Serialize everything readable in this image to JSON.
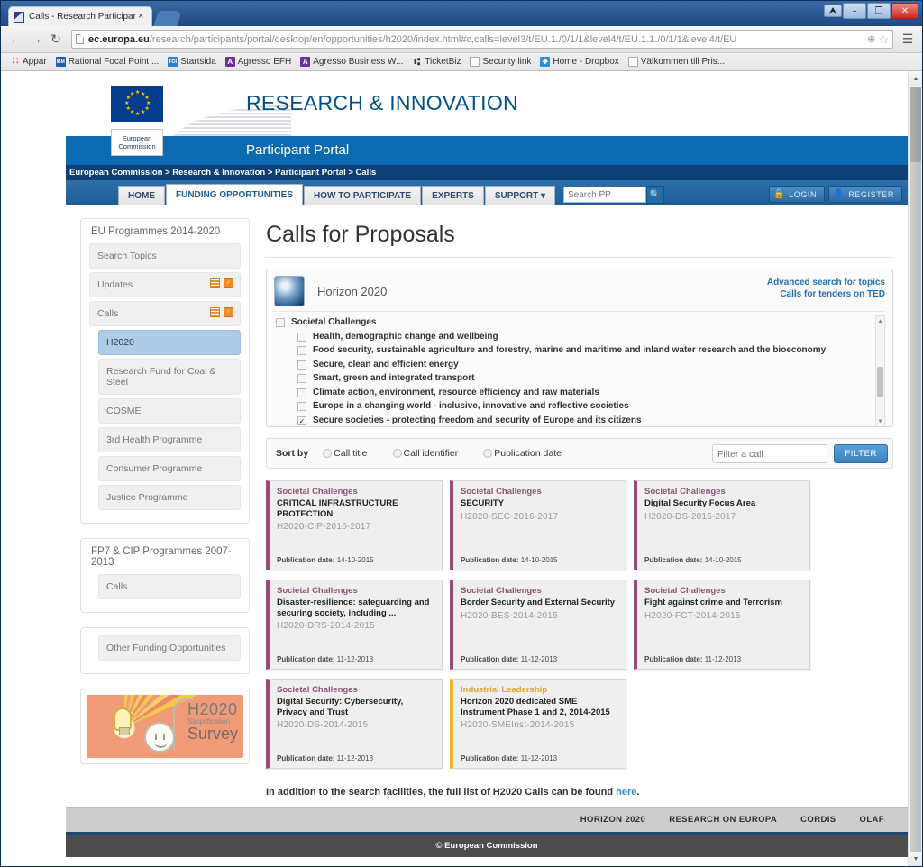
{
  "browser": {
    "tab_title": "Calls - Research Participar",
    "tab_close": "×",
    "back_icon": "←",
    "forward_icon": "→",
    "reload_icon": "↻",
    "url_host": "ec.europa.eu",
    "url_path": "/research/participants/portal/desktop/en/opportunities/h2020/index.html#c,calls=level3/t/EU.1./0/1/1&level4/t/EU.1.1./0/1/1&level4/t/EU",
    "zoom_icon": "⊕",
    "star_icon": "☆",
    "menu_icon": "☰",
    "minimize": "–",
    "maximize": "❐",
    "close": "✕",
    "restore": "⮝",
    "bookmarks": [
      {
        "label": "Appar",
        "icon": "apps-icon",
        "glyph": "∷"
      },
      {
        "label": "Rational Focal Point ...",
        "icon": "ibm-icon",
        "glyph": "IBM"
      },
      {
        "label": "Startsida",
        "icon": "foi-icon",
        "glyph": "FOI"
      },
      {
        "label": "Agresso EFH",
        "icon": "agresso-icon",
        "glyph": "A"
      },
      {
        "label": "Agresso Business W...",
        "icon": "agresso-icon",
        "glyph": "A"
      },
      {
        "label": "TicketBiz",
        "icon": "ticketbiz-icon",
        "glyph": "⑆"
      },
      {
        "label": "Security link",
        "icon": "page-icon",
        "glyph": ""
      },
      {
        "label": "Home - Dropbox",
        "icon": "dropbox-icon",
        "glyph": "❖"
      },
      {
        "label": "Välkommen till Pris...",
        "icon": "page-icon",
        "glyph": ""
      }
    ]
  },
  "site": {
    "brand_title": "RESEARCH & INNOVATION",
    "portal_title": "Participant Portal",
    "ec_badge": "European\nCommission",
    "breadcrumb": "European Commission >  Research & Innovation >  Participant Portal >  Calls",
    "nav": [
      {
        "label": "HOME",
        "active": false
      },
      {
        "label": "FUNDING OPPORTUNITIES",
        "active": true
      },
      {
        "label": "HOW TO PARTICIPATE",
        "active": false
      },
      {
        "label": "EXPERTS",
        "active": false
      },
      {
        "label": "SUPPORT ▾",
        "active": false
      }
    ],
    "search_placeholder": "Search PP",
    "search_value": "",
    "search_icon": "🔍",
    "login_label": "LOGIN",
    "login_icon": "🔒",
    "register_label": "REGISTER",
    "register_icon": "👤"
  },
  "sidebar": {
    "panel1_title": "EU Programmes 2014-2020",
    "panel1_items": [
      {
        "label": "Search Topics",
        "indent": false,
        "active": false,
        "icons": []
      },
      {
        "label": "Updates",
        "indent": false,
        "active": false,
        "icons": [
          "calendar-icon",
          "rss-icon"
        ]
      },
      {
        "label": "Calls",
        "indent": false,
        "active": false,
        "icons": [
          "calendar-icon",
          "rss-icon"
        ]
      },
      {
        "label": "H2020",
        "indent": true,
        "active": true,
        "icons": []
      },
      {
        "label": "Research Fund for Coal & Steel",
        "indent": true,
        "active": false,
        "icons": []
      },
      {
        "label": "COSME",
        "indent": true,
        "active": false,
        "icons": []
      },
      {
        "label": "3rd Health Programme",
        "indent": true,
        "active": false,
        "icons": []
      },
      {
        "label": "Consumer Programme",
        "indent": true,
        "active": false,
        "icons": []
      },
      {
        "label": "Justice Programme",
        "indent": true,
        "active": false,
        "icons": []
      }
    ],
    "panel2_title": "FP7 & CIP Programmes 2007-2013",
    "panel2_items": [
      {
        "label": "Calls",
        "indent": true,
        "active": false,
        "icons": []
      }
    ],
    "panel3_items": [
      {
        "label": "Other Funding Opportunities",
        "indent": true,
        "active": false,
        "icons": []
      }
    ],
    "survey": {
      "line1": "H2020",
      "line2": "Simplification",
      "line3": "Survey"
    }
  },
  "main": {
    "page_title": "Calls for Proposals",
    "programme_name": "Horizon 2020",
    "advanced_search_link": "Advanced search for topics",
    "ted_link": "Calls for tenders on TED",
    "tree": [
      {
        "level": 0,
        "label": "Societal Challenges",
        "checked": false
      },
      {
        "level": 1,
        "label": "Health, demographic change and wellbeing",
        "checked": false
      },
      {
        "level": 1,
        "label": "Food security, sustainable agriculture and forestry, marine and maritime and inland water research and the bioeconomy",
        "checked": false
      },
      {
        "level": 1,
        "label": "Secure, clean and efficient energy",
        "checked": false
      },
      {
        "level": 1,
        "label": "Smart, green and integrated transport",
        "checked": false
      },
      {
        "level": 1,
        "label": "Climate action, environment, resource efficiency and raw materials",
        "checked": false
      },
      {
        "level": 1,
        "label": "Europe in a changing world - inclusive, innovative and reflective societies",
        "checked": false
      },
      {
        "level": 1,
        "label": "Secure societies - protecting freedom and security of Europe and its citizens",
        "checked": true
      }
    ],
    "sort": {
      "label": "Sort by",
      "options": [
        {
          "label": "Call title",
          "selected": false
        },
        {
          "label": "Call identifier",
          "selected": false
        },
        {
          "label": "Publication date",
          "selected": false
        }
      ],
      "filter_placeholder": "Filter a call",
      "filter_value": "",
      "filter_button": "FILTER"
    },
    "pub_prefix": "Publication date:",
    "cards": [
      {
        "category": "Societal Challenges",
        "title": "CRITICAL INFRASTRUCTURE PROTECTION",
        "identifier": "H2020-CIP-2016-2017",
        "pub_date": "14-10-2015",
        "accent": "societal"
      },
      {
        "category": "Societal Challenges",
        "title": "SECURITY",
        "identifier": "H2020-SEC-2016-2017",
        "pub_date": "14-10-2015",
        "accent": "societal"
      },
      {
        "category": "Societal Challenges",
        "title": "Digital Security Focus Area",
        "identifier": "H2020-DS-2016-2017",
        "pub_date": "14-10-2015",
        "accent": "societal"
      },
      {
        "category": "Societal Challenges",
        "title": "Disaster-resilience: safeguarding and securing society, including ...",
        "identifier": "H2020-DRS-2014-2015",
        "pub_date": "11-12-2013",
        "accent": "societal"
      },
      {
        "category": "Societal Challenges",
        "title": "Border Security and External Security",
        "identifier": "H2020-BES-2014-2015",
        "pub_date": "11-12-2013",
        "accent": "societal"
      },
      {
        "category": "Societal Challenges",
        "title": "Fight against crime and Terrorism",
        "identifier": "H2020-FCT-2014-2015",
        "pub_date": "11-12-2013",
        "accent": "societal"
      },
      {
        "category": "Societal Challenges",
        "title": "Digital Security: Cybersecurity, Privacy and Trust",
        "identifier": "H2020-DS-2014-2015",
        "pub_date": "11-12-2013",
        "accent": "societal"
      },
      {
        "category": "Industrial Leadership",
        "title": "Horizon 2020 dedicated SME Instrument Phase 1 and 2, 2014-2015",
        "identifier": "H2020-SMEInst-2014-2015",
        "pub_date": "11-12-2013",
        "accent": "industrial"
      }
    ],
    "fulllist_text": "In addition to the search facilities, the full list of H2020 Calls can be found ",
    "fulllist_link": "here",
    "fulllist_suffix": "."
  },
  "footer": {
    "links": [
      "HORIZON 2020",
      "RESEARCH ON EUROPA",
      "CORDIS",
      "OLAF"
    ],
    "copyright": "© European Commission"
  },
  "colors": {
    "brand_blue": "#00508c",
    "portal_blue": "#0b6ab0",
    "breadcrumb_blue": "#0d3f74",
    "societal_accent": "#9a4b78",
    "industrial_accent": "#f0b323",
    "link_blue": "#1f6fb5",
    "highlight": "#aecbe8"
  }
}
